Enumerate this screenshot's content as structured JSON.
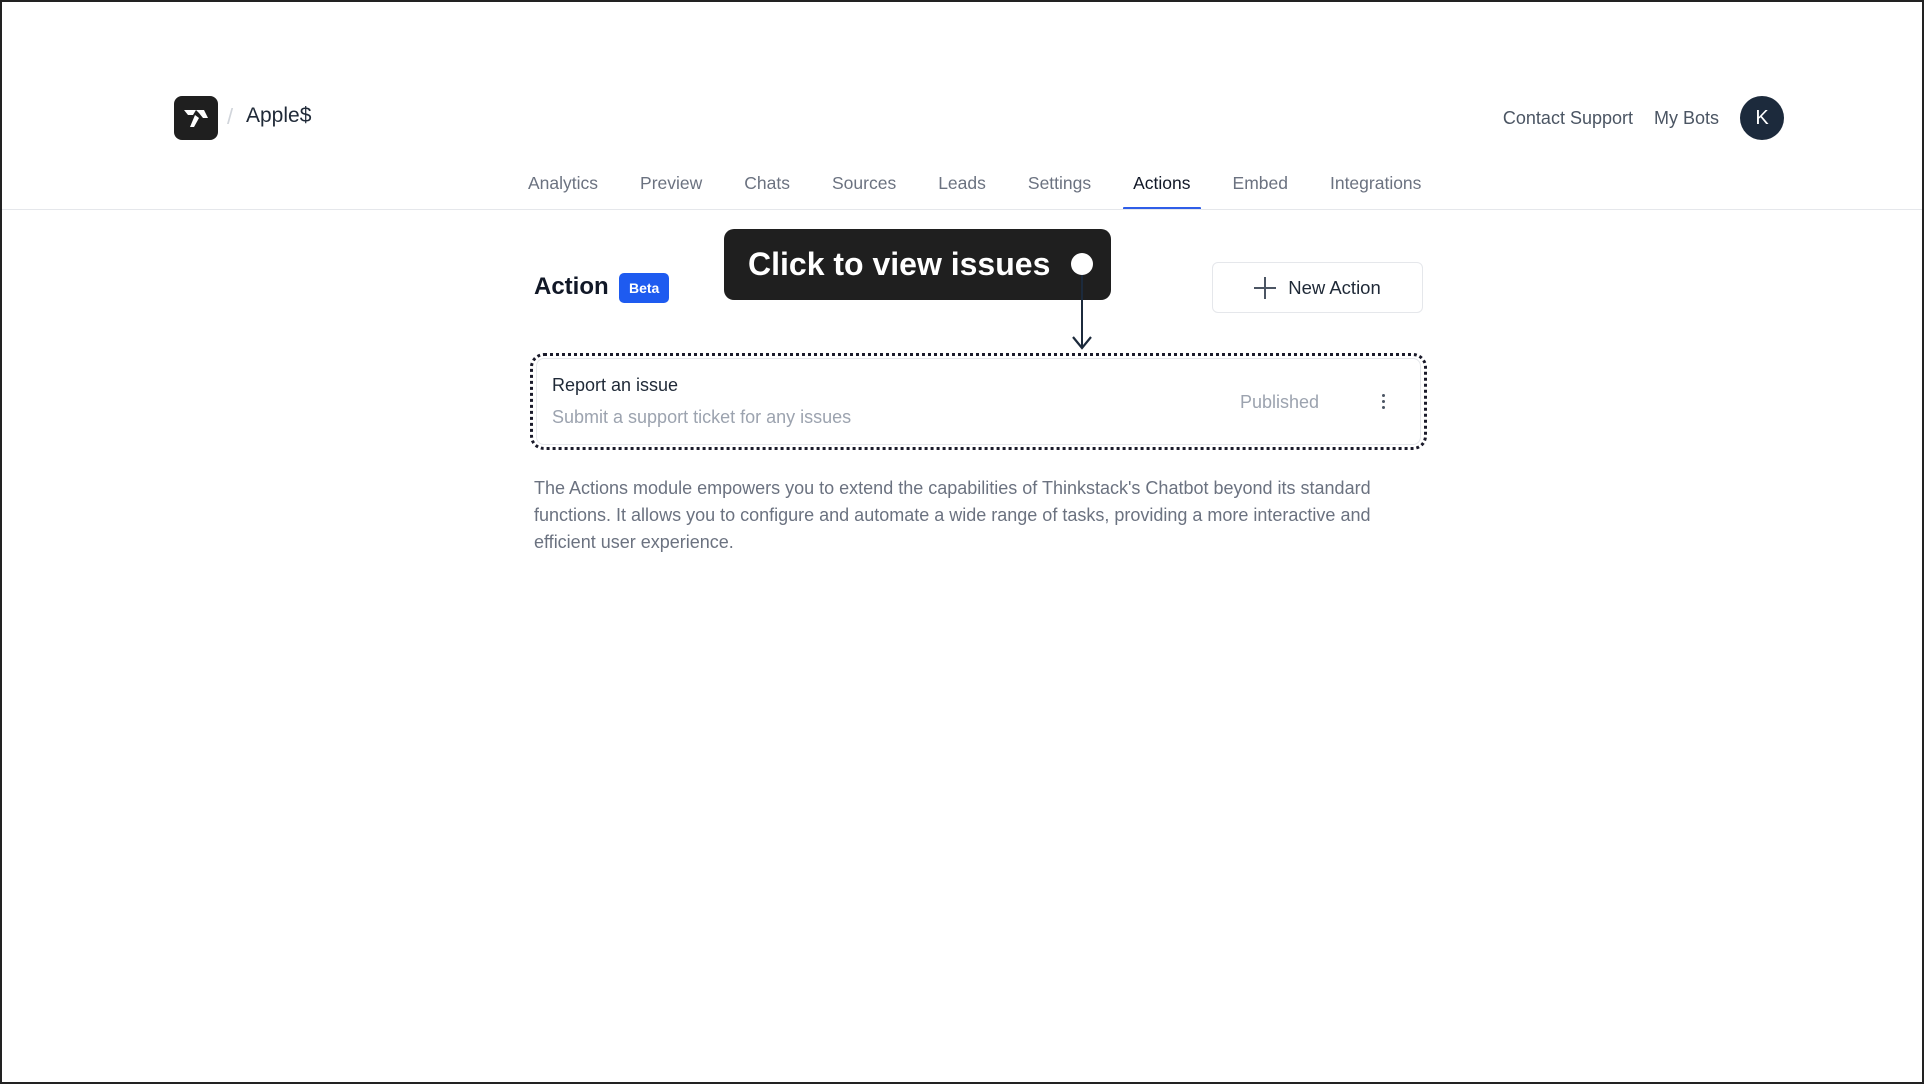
{
  "header": {
    "logo_icon": "thinkstack-logo-icon",
    "breadcrumb_separator": "/",
    "bot_name": "Apple$",
    "contact_support": "Contact Support",
    "my_bots": "My Bots",
    "avatar_initial": "K"
  },
  "tabs": [
    {
      "label": "Analytics",
      "active": false
    },
    {
      "label": "Preview",
      "active": false
    },
    {
      "label": "Chats",
      "active": false
    },
    {
      "label": "Sources",
      "active": false
    },
    {
      "label": "Leads",
      "active": false
    },
    {
      "label": "Settings",
      "active": false
    },
    {
      "label": "Actions",
      "active": true
    },
    {
      "label": "Embed",
      "active": false
    },
    {
      "label": "Integrations",
      "active": false
    }
  ],
  "section": {
    "title": "Action",
    "badge": "Beta",
    "new_action_label": "New Action",
    "new_action_icon": "plus-icon"
  },
  "actions": [
    {
      "title": "Report an issue",
      "description": "Submit a support ticket for any issues",
      "status": "Published",
      "menu_icon": "kebab-menu-icon"
    }
  ],
  "description": "The Actions module empowers you to extend the capabilities of Thinkstack's Chatbot beyond its standard functions. It allows you to configure and automate a wide range of tasks, providing a more interactive and efficient user experience.",
  "annotation": {
    "text": "Click to view issues"
  },
  "colors": {
    "accent": "#2f5ee8",
    "badge": "#1e5bf0",
    "avatar": "#1c2a3c",
    "tooltip_bg": "#1f1f1f"
  }
}
